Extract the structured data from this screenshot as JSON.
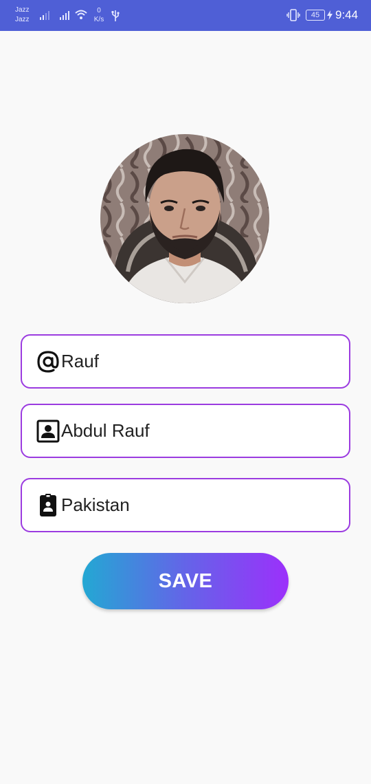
{
  "status_bar": {
    "carrier_1": "Jazz",
    "carrier_2": "Jazz",
    "net_speed_value": "0",
    "net_speed_unit": "K/s",
    "battery_level": "45",
    "time": "9:44",
    "background_color": "#4f5fd6"
  },
  "profile": {
    "avatar_icon": "profile-photo"
  },
  "form": {
    "username": {
      "icon": "at-sign-icon",
      "value": "Rauf"
    },
    "full_name": {
      "icon": "contact-card-icon",
      "value": "Abdul Rauf"
    },
    "country": {
      "icon": "badge-icon",
      "value": "Pakistan"
    },
    "border_color": "#9b3be0"
  },
  "actions": {
    "save_label": "SAVE",
    "save_gradient": [
      "#23a8d3",
      "#9c30fb"
    ]
  }
}
